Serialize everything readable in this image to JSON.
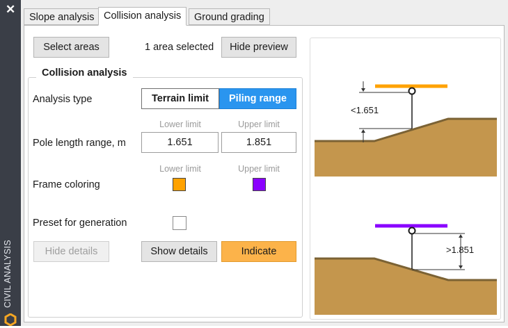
{
  "sidebar": {
    "close_symbol": "✕",
    "vertical_title": "CIVIL ANALYSIS"
  },
  "tabs": [
    "Slope analysis",
    "Collision analysis",
    "Ground grading"
  ],
  "toolbar": {
    "select_areas": "Select areas",
    "selection_status": "1 area selected",
    "hide_preview": "Hide preview"
  },
  "group": {
    "title": "Collision analysis",
    "analysis_type_label": "Analysis type",
    "analysis_options": [
      "Terrain limit",
      "Piling range"
    ],
    "analysis_selected": "Piling range",
    "lower_limit_hint": "Lower limit",
    "upper_limit_hint": "Upper limit",
    "pole_length_label": "Pole length range, m",
    "pole_lower": "1.651",
    "pole_upper": "1.851",
    "frame_coloring_label": "Frame coloring",
    "lower_color": "#ffa200",
    "upper_color": "#8a00ff",
    "preset_label": "Preset for generation",
    "preset_checked": false,
    "hide_details": "Hide details",
    "show_details": "Show details",
    "indicate": "Indicate"
  },
  "preview": {
    "top_label": "<1.651",
    "bottom_label": ">1.851",
    "ground_color": "#c4964d",
    "ground_edge_color": "#7b6234"
  },
  "colors": {
    "accent_blue": "#2a95ef",
    "indicate_orange": "#fcb34a"
  }
}
